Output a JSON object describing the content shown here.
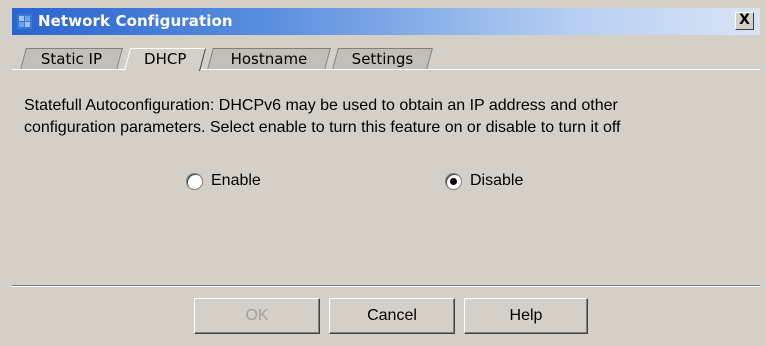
{
  "window": {
    "title": "Network Configuration",
    "close_label": "X"
  },
  "tabs": [
    {
      "label": "Static IP",
      "active": false
    },
    {
      "label": "DHCP",
      "active": true
    },
    {
      "label": "Hostname",
      "active": false
    },
    {
      "label": "Settings",
      "active": false
    }
  ],
  "panel": {
    "description_line1": "Statefull Autoconfiguration: DHCPv6 may be used to obtain an IP address and other",
    "description_line2": "configuration parameters. Select enable to turn this feature on or disable to turn it off",
    "options": [
      {
        "label": "Enable",
        "selected": false
      },
      {
        "label": "Disable",
        "selected": true
      }
    ]
  },
  "buttons": {
    "ok_label": "OK",
    "ok_enabled": false,
    "cancel_label": "Cancel",
    "help_label": "Help"
  },
  "colors": {
    "titlebar_start": "#2a64cf",
    "titlebar_end": "#d8e4f6",
    "dialog_bg": "#d4d0c8"
  },
  "icons": {
    "app": "network-config-icon",
    "close": "close-icon"
  }
}
